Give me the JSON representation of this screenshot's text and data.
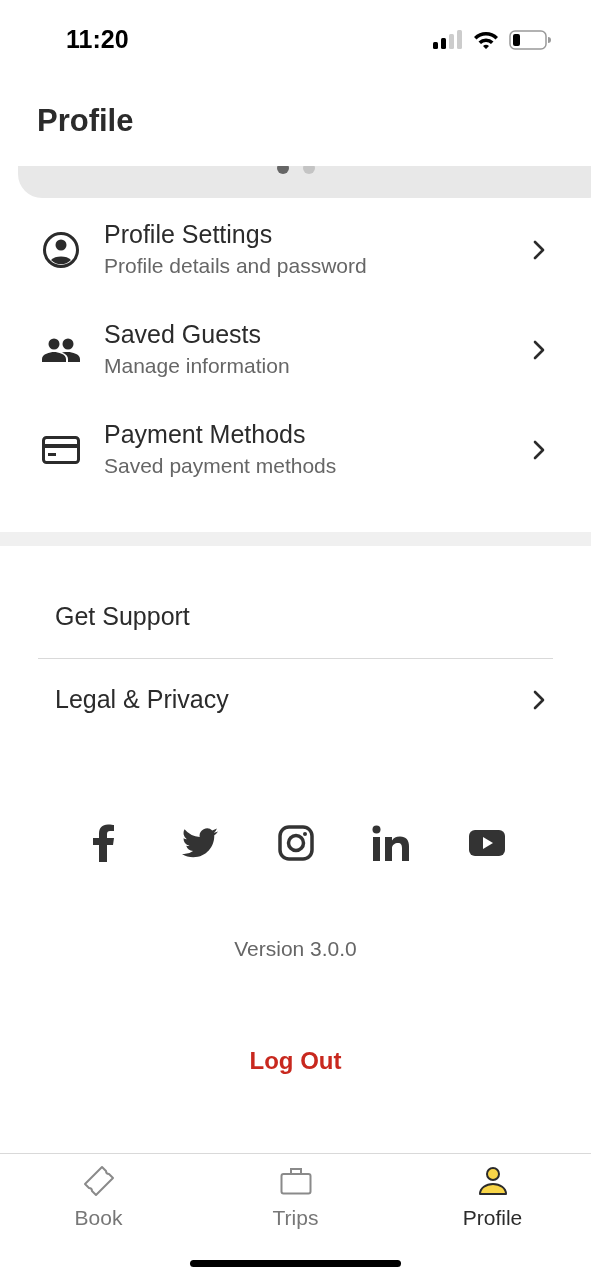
{
  "status_bar": {
    "time": "11:20"
  },
  "header": {
    "title": "Profile"
  },
  "carousel": {
    "dots": [
      {
        "selected": true
      },
      {
        "selected": false
      }
    ]
  },
  "account_items": [
    {
      "kind": "person",
      "title": "Profile Settings",
      "subtitle": "Profile details and password"
    },
    {
      "kind": "people",
      "title": "Saved Guests",
      "subtitle": "Manage information"
    },
    {
      "kind": "card",
      "title": "Payment Methods",
      "subtitle": "Saved payment methods"
    }
  ],
  "links": [
    {
      "label": "Get Support",
      "chevron": false
    },
    {
      "label": "Legal & Privacy",
      "chevron": true
    }
  ],
  "social": [
    {
      "kind": "facebook"
    },
    {
      "kind": "twitter"
    },
    {
      "kind": "instagram"
    },
    {
      "kind": "linkedin"
    },
    {
      "kind": "youtube"
    }
  ],
  "version": "Version 3.0.0",
  "logout": "Log Out",
  "tabs": [
    {
      "kind": "ticket",
      "label": "Book",
      "selected": false
    },
    {
      "kind": "briefcase",
      "label": "Trips",
      "selected": false
    },
    {
      "kind": "person",
      "label": "Profile",
      "selected": true
    }
  ]
}
